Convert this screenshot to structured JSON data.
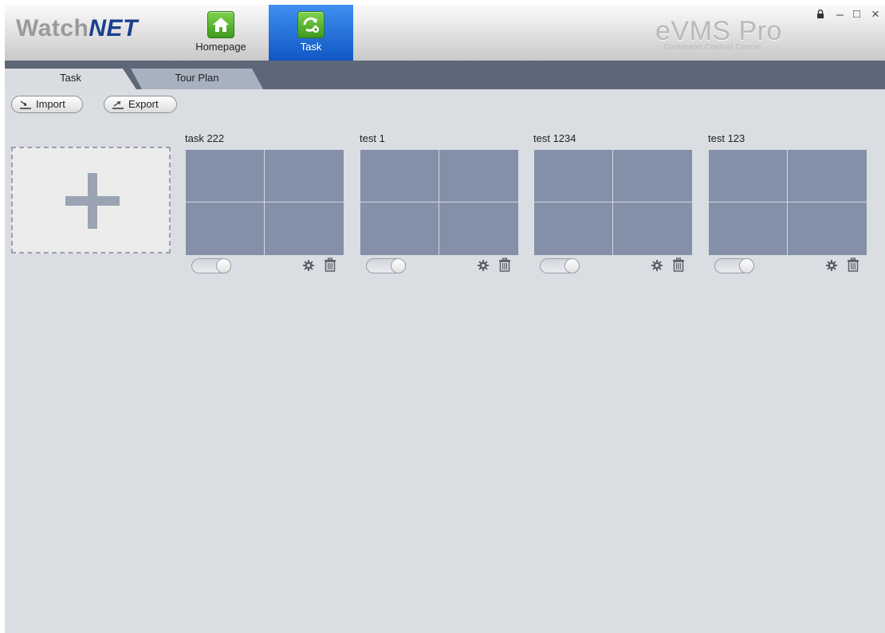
{
  "app": {
    "brand_prefix": "Watch",
    "brand_suffix": "NET",
    "product_name": "eVMS Pro",
    "product_subtitle": "Command Control Center",
    "nav": [
      {
        "label": "Homepage",
        "icon": "home-icon",
        "active": false
      },
      {
        "label": "Task",
        "icon": "task-refresh-icon",
        "active": true
      }
    ],
    "window_controls": [
      {
        "name": "lock-icon",
        "glyph": "🔒"
      },
      {
        "name": "minimize-icon",
        "glyph": "–"
      },
      {
        "name": "maximize-icon",
        "glyph": "□"
      },
      {
        "name": "close-icon",
        "glyph": "×"
      }
    ]
  },
  "tabs": [
    {
      "label": "Task",
      "active": true
    },
    {
      "label": "Tour Plan",
      "active": false
    }
  ],
  "toolbar": {
    "import_label": "Import",
    "export_label": "Export"
  },
  "tasks": [
    {
      "name": "task 222",
      "enabled": false
    },
    {
      "name": "test 1",
      "enabled": false
    },
    {
      "name": "test 1234",
      "enabled": false
    },
    {
      "name": "test 123",
      "enabled": false
    }
  ],
  "colors": {
    "accent_blue": "#1b5fd0",
    "preview_fill": "#8390a7",
    "tab_bar": "#5d6777"
  }
}
